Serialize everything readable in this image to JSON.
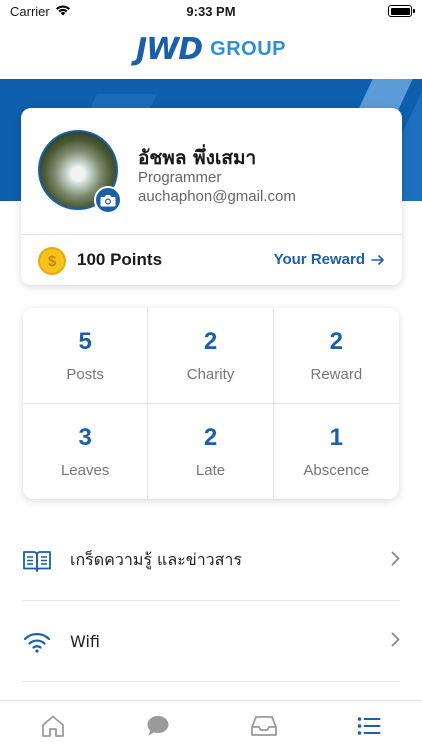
{
  "status_bar": {
    "carrier": "Carrier",
    "time": "9:33 PM"
  },
  "header": {
    "logo_main": "JWD",
    "logo_sub": "GROUP",
    "banner_color": "#0e5fae"
  },
  "profile": {
    "name": "อัชพล พึ่งเสมา",
    "role": "Programmer",
    "email": "auchaphon@gmail.com",
    "points": "100 Points",
    "coin_symbol": "$",
    "reward_link": "Your Reward"
  },
  "stats": [
    {
      "value": "5",
      "label": "Posts"
    },
    {
      "value": "2",
      "label": "Charity"
    },
    {
      "value": "2",
      "label": "Reward"
    },
    {
      "value": "3",
      "label": "Leaves"
    },
    {
      "value": "2",
      "label": "Late"
    },
    {
      "value": "1",
      "label": "Abscence"
    }
  ],
  "menu": [
    {
      "label": "เกร็ดความรู้ และข่าวสาร",
      "icon": "book-icon"
    },
    {
      "label": "Wifi",
      "icon": "wifi-icon"
    }
  ],
  "tabs": [
    {
      "icon": "home-icon"
    },
    {
      "icon": "chat-icon"
    },
    {
      "icon": "inbox-icon"
    },
    {
      "icon": "list-icon",
      "active": true
    }
  ],
  "colors": {
    "accent": "#1a5fa8",
    "tab_active": "#1a5fa8",
    "tab_inactive": "#9a9a9a"
  }
}
